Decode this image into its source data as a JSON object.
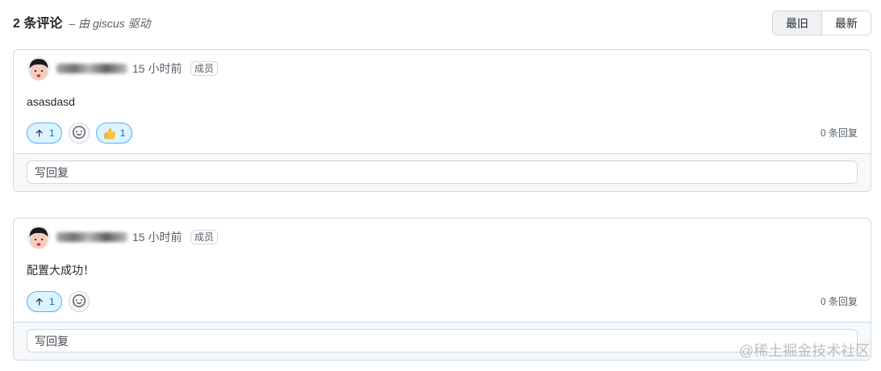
{
  "header": {
    "comment_count_label": "2 条评论",
    "powered_by_prefix": "– 由 ",
    "powered_by_link": "giscus",
    "powered_by_suffix": " 驱动",
    "sort_options": [
      {
        "label": "最旧",
        "selected": true
      },
      {
        "label": "最新",
        "selected": false
      }
    ]
  },
  "comments": [
    {
      "time": "15 小时前",
      "badge": "成员",
      "body": "asasdasd",
      "reactions": [
        {
          "icon": "arrow-up-icon",
          "count": 1
        },
        {
          "icon": "thumbs-up-icon",
          "count": 1
        }
      ],
      "add_reaction_icon": "smiley-icon",
      "reply_count": "0 条回复",
      "reply_placeholder": "写回复"
    },
    {
      "time": "15 小时前",
      "badge": "成员",
      "body": "配置大成功！",
      "reactions": [
        {
          "icon": "arrow-up-icon",
          "count": 1
        }
      ],
      "add_reaction_icon": "smiley-icon",
      "reply_count": "0 条回复",
      "reply_placeholder": "写回复"
    }
  ],
  "watermark": "@稀土掘金技术社区",
  "colors": {
    "accent": "#0969da",
    "reaction_bg": "#ddf4ff",
    "reaction_border": "#54aeff",
    "muted_text": "#57606a",
    "card_border": "#c8dcee"
  }
}
